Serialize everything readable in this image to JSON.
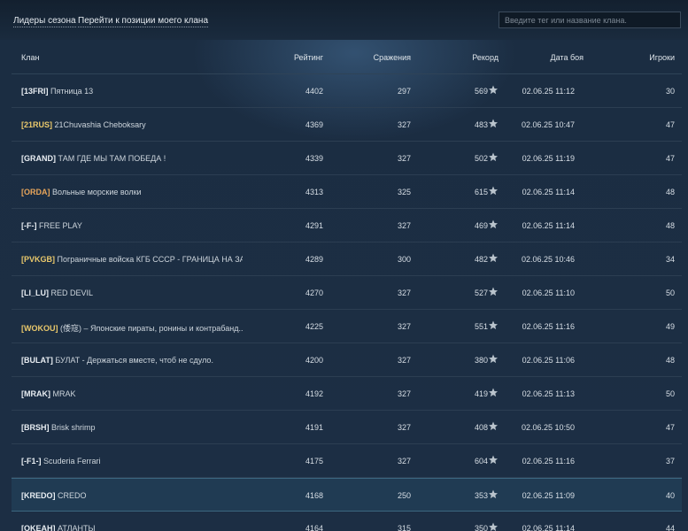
{
  "header": {
    "tab_leaders": "Лидеры сезона",
    "tab_goto": "Перейти к позиции моего клана",
    "search_placeholder": "Введите тег или название клана."
  },
  "columns": {
    "clan": "Клан",
    "rating": "Рейтинг",
    "battles": "Сражения",
    "record": "Рекорд",
    "date": "Дата боя",
    "players": "Игроки"
  },
  "colors": {
    "tag_gold": "#e9c86b",
    "tag_orange": "#e8a55a",
    "star": "#b9c3cc"
  },
  "rows": [
    {
      "tag": "[13FRI]",
      "name": "Пятница 13",
      "rating": "4402",
      "battles": "297",
      "record": "569",
      "date": "02.06.25 11:12",
      "players": "30",
      "tag_color": "white"
    },
    {
      "tag": "[21RUS]",
      "name": "21Chuvashia Cheboksary",
      "rating": "4369",
      "battles": "327",
      "record": "483",
      "date": "02.06.25 10:47",
      "players": "47",
      "tag_color": "gold"
    },
    {
      "tag": "[GRAND]",
      "name": "ТАМ ГДЕ МЫ ТАМ ПОБЕДА !",
      "rating": "4339",
      "battles": "327",
      "record": "502",
      "date": "02.06.25 11:19",
      "players": "47",
      "tag_color": "white"
    },
    {
      "tag": "[ORDA]",
      "name": "Вольные морские волки",
      "rating": "4313",
      "battles": "325",
      "record": "615",
      "date": "02.06.25 11:14",
      "players": "48",
      "tag_color": "orange"
    },
    {
      "tag": "[-F-]",
      "name": "FREE PLAY",
      "rating": "4291",
      "battles": "327",
      "record": "469",
      "date": "02.06.25 11:14",
      "players": "48",
      "tag_color": "white"
    },
    {
      "tag": "[PVKGB]",
      "name": "Пограничные войска КГБ СССР - ГРАНИЦА НА ЗА...",
      "rating": "4289",
      "battles": "300",
      "record": "482",
      "date": "02.06.25 10:46",
      "players": "34",
      "tag_color": "gold"
    },
    {
      "tag": "[LI_LU]",
      "name": "RED DEVIL",
      "rating": "4270",
      "battles": "327",
      "record": "527",
      "date": "02.06.25 11:10",
      "players": "50",
      "tag_color": "white"
    },
    {
      "tag": "[WOKOU]",
      "name": "(倭寇) – Японские пираты, ронины и контрабанд...",
      "rating": "4225",
      "battles": "327",
      "record": "551",
      "date": "02.06.25 11:16",
      "players": "49",
      "tag_color": "gold"
    },
    {
      "tag": "[BULAT]",
      "name": "БУЛАТ - Держаться вместе, чтоб не сдуло.",
      "rating": "4200",
      "battles": "327",
      "record": "380",
      "date": "02.06.25 11:06",
      "players": "48",
      "tag_color": "white"
    },
    {
      "tag": "[MRAK]",
      "name": "MRAK",
      "rating": "4192",
      "battles": "327",
      "record": "419",
      "date": "02.06.25 11:13",
      "players": "50",
      "tag_color": "white"
    },
    {
      "tag": "[BRSH]",
      "name": "Brisk shrimp",
      "rating": "4191",
      "battles": "327",
      "record": "408",
      "date": "02.06.25 10:50",
      "players": "47",
      "tag_color": "white"
    },
    {
      "tag": "[-F1-]",
      "name": "Scuderia Ferrari",
      "rating": "4175",
      "battles": "327",
      "record": "604",
      "date": "02.06.25 11:16",
      "players": "37",
      "tag_color": "white"
    },
    {
      "tag": "[KREDO]",
      "name": "CREDO",
      "rating": "4168",
      "battles": "250",
      "record": "353",
      "date": "02.06.25 11:09",
      "players": "40",
      "tag_color": "white",
      "highlighted": true
    },
    {
      "tag": "[OKEAH]",
      "name": "АТЛАНТЫ",
      "rating": "4164",
      "battles": "315",
      "record": "350",
      "date": "02.06.25 11:14",
      "players": "44",
      "tag_color": "white"
    }
  ]
}
